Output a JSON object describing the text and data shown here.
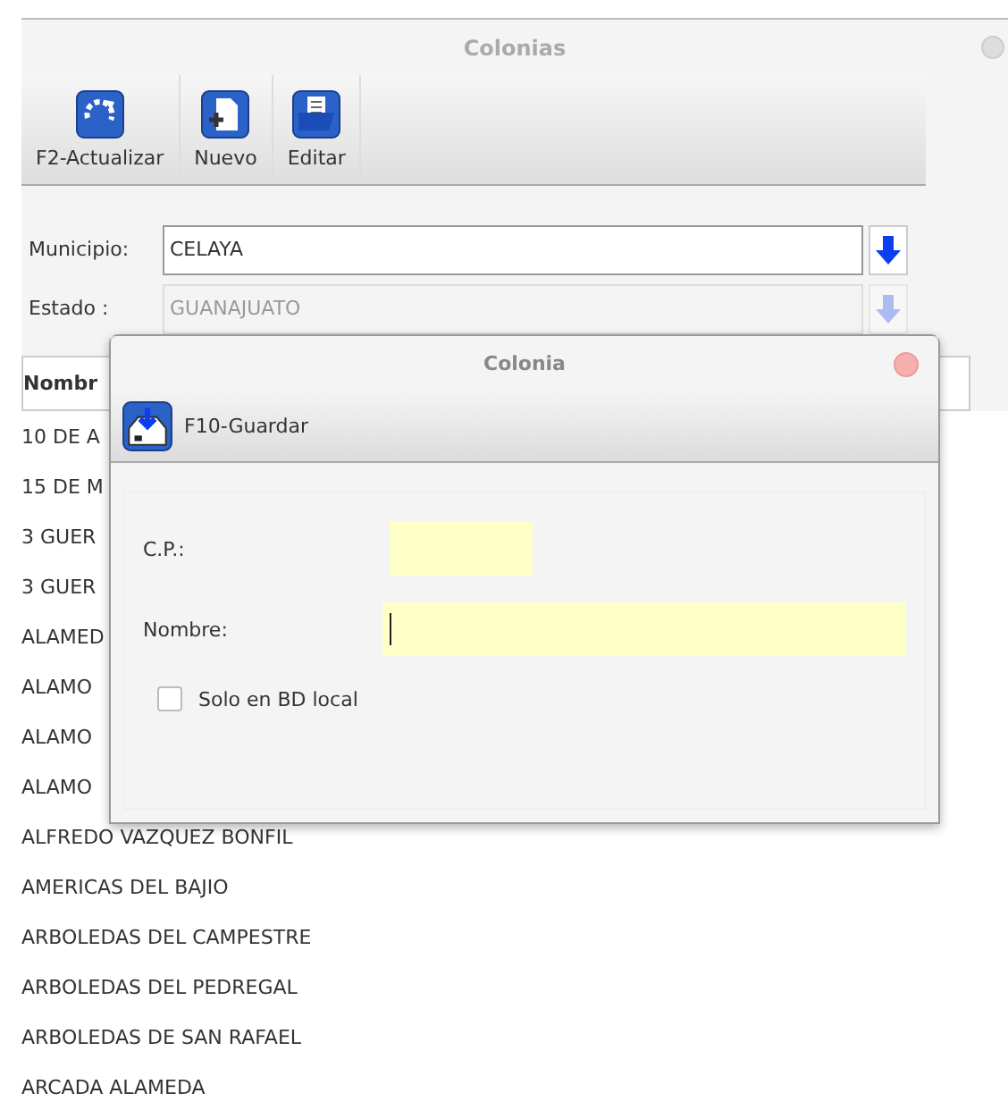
{
  "window": {
    "title": "Colonias"
  },
  "toolbar": [
    {
      "label": "F2-Actualizar",
      "kind": "refresh"
    },
    {
      "label": "Nuevo",
      "kind": "new"
    },
    {
      "label": "Editar",
      "kind": "edit"
    }
  ],
  "municipio": {
    "label": "Municipio:",
    "value": "CELAYA"
  },
  "estado": {
    "label": "Estado :",
    "value": "GUANAJUATO",
    "disabled": true
  },
  "table": {
    "column": "Nombr",
    "rows": [
      "10 DE A",
      "15 DE M",
      "3 GUER",
      "3 GUER",
      "ALAMED",
      "ALAMO",
      "ALAMO",
      "ALAMO",
      "ALFREDO VAZQUEZ BONFIL",
      "AMERICAS DEL BAJIO",
      "ARBOLEDAS DEL CAMPESTRE",
      "ARBOLEDAS DEL PEDREGAL",
      "ARBOLEDAS DE SAN RAFAEL",
      "ARCADA ALAMEDA"
    ]
  },
  "dialog": {
    "title": "Colonia",
    "save_label": "F10-Guardar",
    "cp_label": "C.P.:",
    "nombre_label": "Nombre:",
    "checkbox": {
      "label": "Solo en BD local",
      "checked": false
    }
  }
}
